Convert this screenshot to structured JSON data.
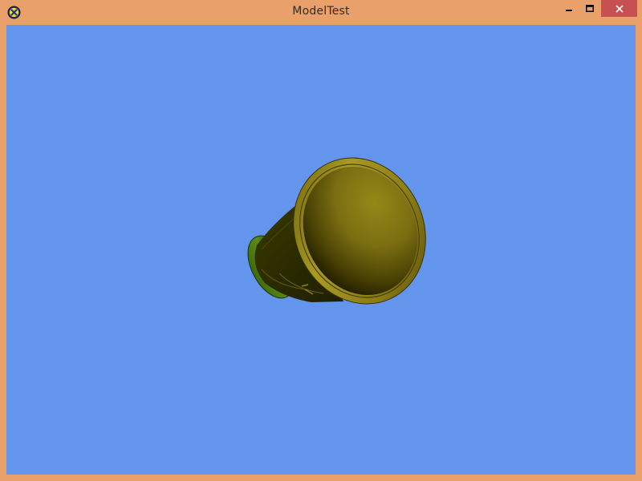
{
  "window": {
    "title": "ModelTest",
    "app_icon": "app-icon-yellow-x",
    "controls": {
      "minimize_icon": "minimize-icon",
      "maximize_icon": "maximize-icon",
      "close_icon": "close-icon"
    }
  },
  "colors": {
    "frame": "#e9a06a",
    "viewport_background": "#6495ed",
    "close_button": "#c75050",
    "model_gold": "#8c7d14",
    "model_dark": "#2a2a00",
    "model_green": "#4f7a10"
  }
}
